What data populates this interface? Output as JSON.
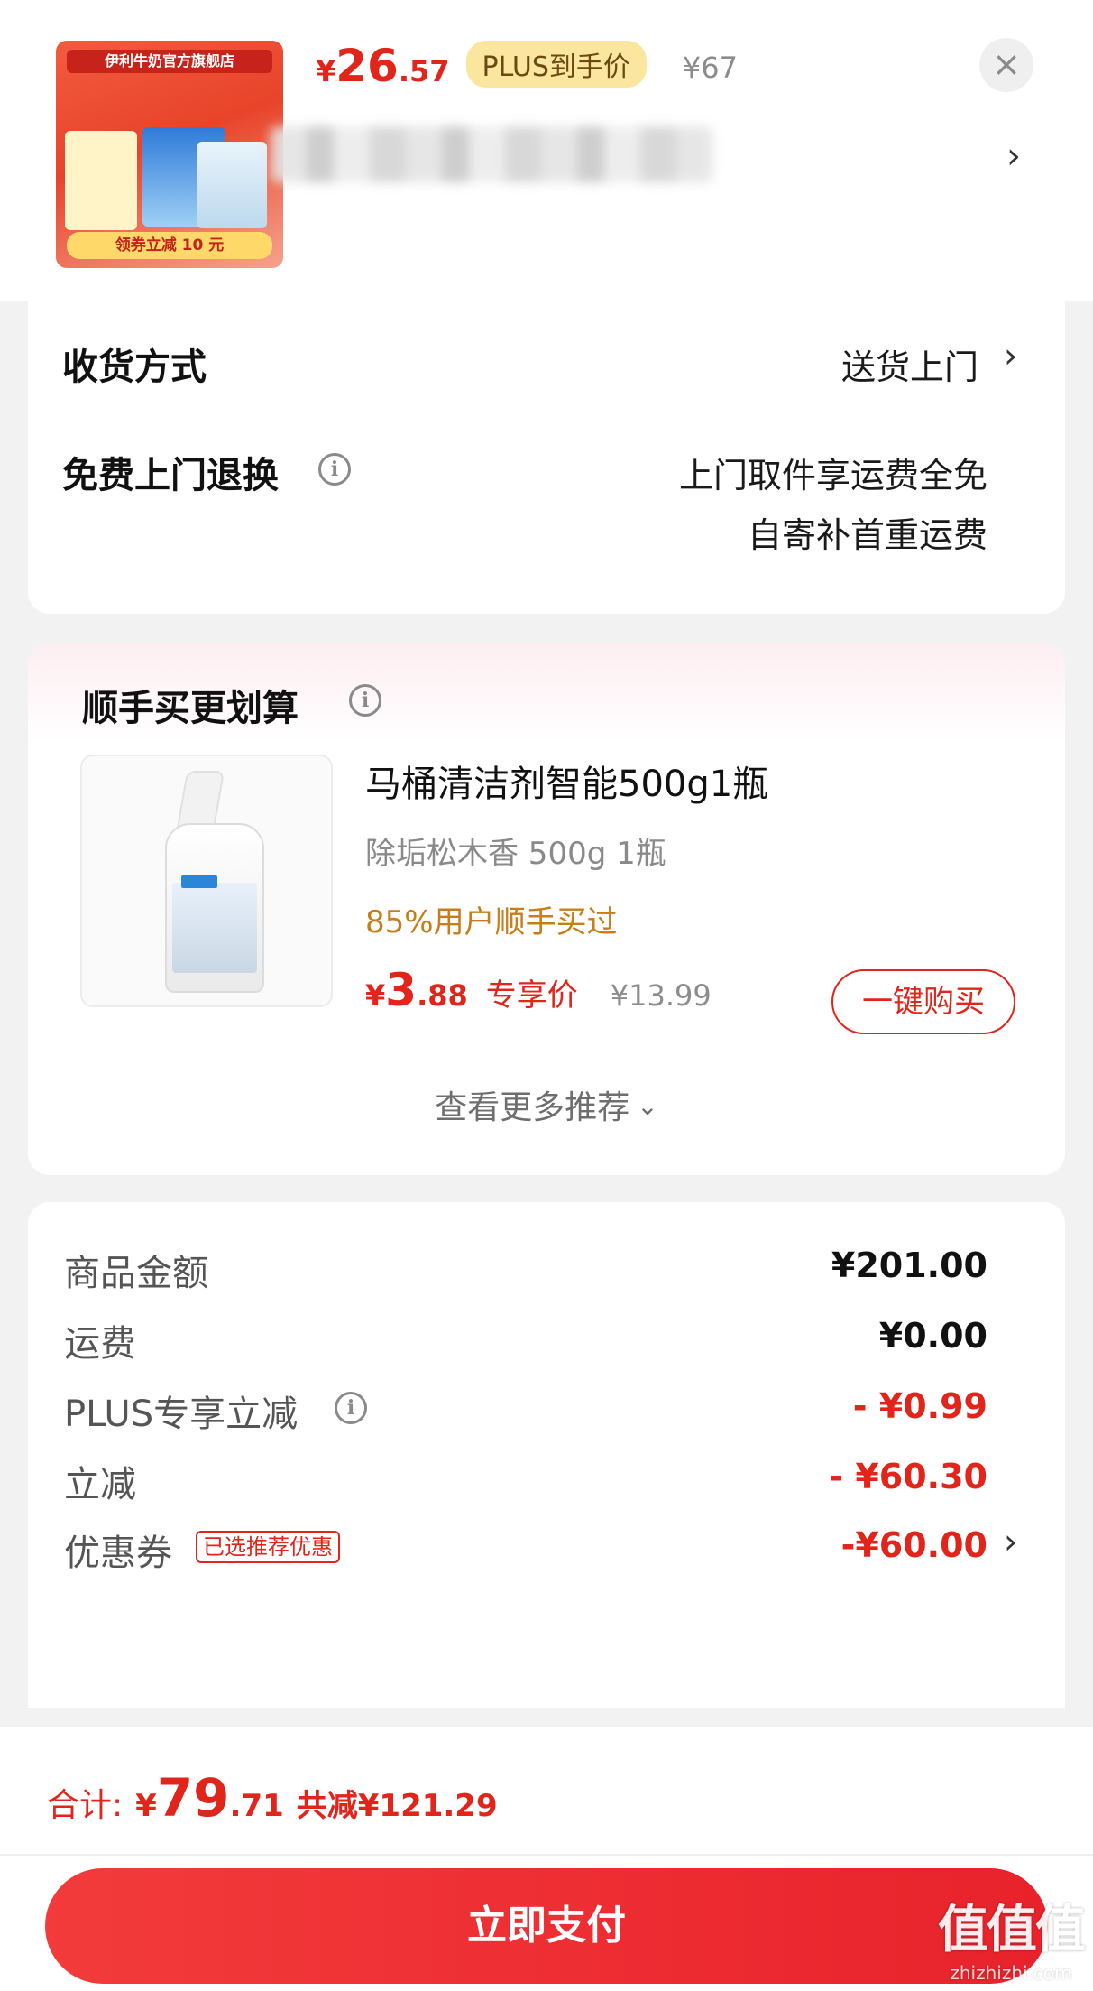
{
  "header": {
    "thumbnail": {
      "store_text": "伊利牛奶官方旗舰店",
      "coupon_text": "领券立减 10 元"
    },
    "price": {
      "currency": "¥",
      "integer": "26",
      "decimal": ".57"
    },
    "plus_tag": "PLUS到手价",
    "original_price": "¥67",
    "close_icon": "close-icon",
    "chevron": "›"
  },
  "delivery": {
    "method_label": "收货方式",
    "method_value": "送货上门",
    "return_label": "免费上门退换",
    "return_value_line1": "上门取件享运费全免",
    "return_value_line2": "自寄补首重运费"
  },
  "recommend": {
    "title": "顺手买更划算",
    "product_name": "马桶清洁剂智能500g1瓶",
    "product_spec": "除垢松木香 500g 1瓶",
    "bought_text": "85%用户顺手买过",
    "price": {
      "currency": "¥",
      "integer": "3",
      "decimal": ".88"
    },
    "exclusive_label": "专享价",
    "original_price": "¥13.99",
    "buy_button": "一键购买",
    "more_label": "查看更多推荐"
  },
  "summary": {
    "rows": [
      {
        "label": "商品金额",
        "value": "¥201.00"
      },
      {
        "label": "运费",
        "value": "¥0.00"
      },
      {
        "label": "PLUS专享立减",
        "value": "- ¥0.99"
      },
      {
        "label": "立减",
        "value": "- ¥60.30"
      },
      {
        "label": "优惠券",
        "value": "-¥60.00"
      }
    ],
    "coupon_badge": "已选推荐优惠"
  },
  "footer": {
    "total_label": "合计:",
    "total_price": {
      "currency": "¥",
      "integer": "79",
      "decimal": ".71"
    },
    "total_off": "共减¥121.29",
    "pay_button": "立即支付"
  },
  "watermark": {
    "main": "值值值",
    "sub": "zhizhizhi.com"
  },
  "colors": {
    "accent_red": "#e1251b",
    "plus_gold": "#fbe6a0",
    "bought_orange": "#c77d1a"
  }
}
